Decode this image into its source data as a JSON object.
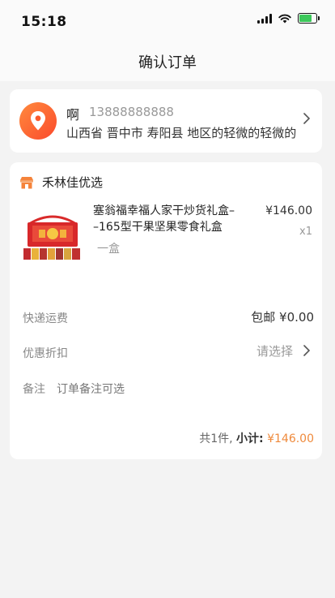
{
  "status_bar": {
    "time": "15:18"
  },
  "header": {
    "title": "确认订单"
  },
  "address": {
    "name": "啊",
    "phone": "13888888888",
    "full_address": "山西省 晋中市 寿阳县 地区的轻微的轻微的"
  },
  "shop": {
    "name": "禾林佳优选"
  },
  "product": {
    "title": "塞翁福幸福人家干炒货礼盒–\n–165型干果坚果零食礼盒",
    "spec": "一盒",
    "price": "¥146.00",
    "quantity": "x1"
  },
  "shipping": {
    "label": "快递运费",
    "value": "包邮 ¥0.00"
  },
  "coupon": {
    "label": "优惠折扣",
    "value": "请选择"
  },
  "note": {
    "label": "备注",
    "hint": "订单备注可选"
  },
  "summary": {
    "count": "共1件,",
    "subtotal_label": "小计:",
    "subtotal_value": "¥146.00"
  },
  "colors": {
    "accent": "#ef8a3c",
    "location_badge": "#fb5a2c"
  }
}
